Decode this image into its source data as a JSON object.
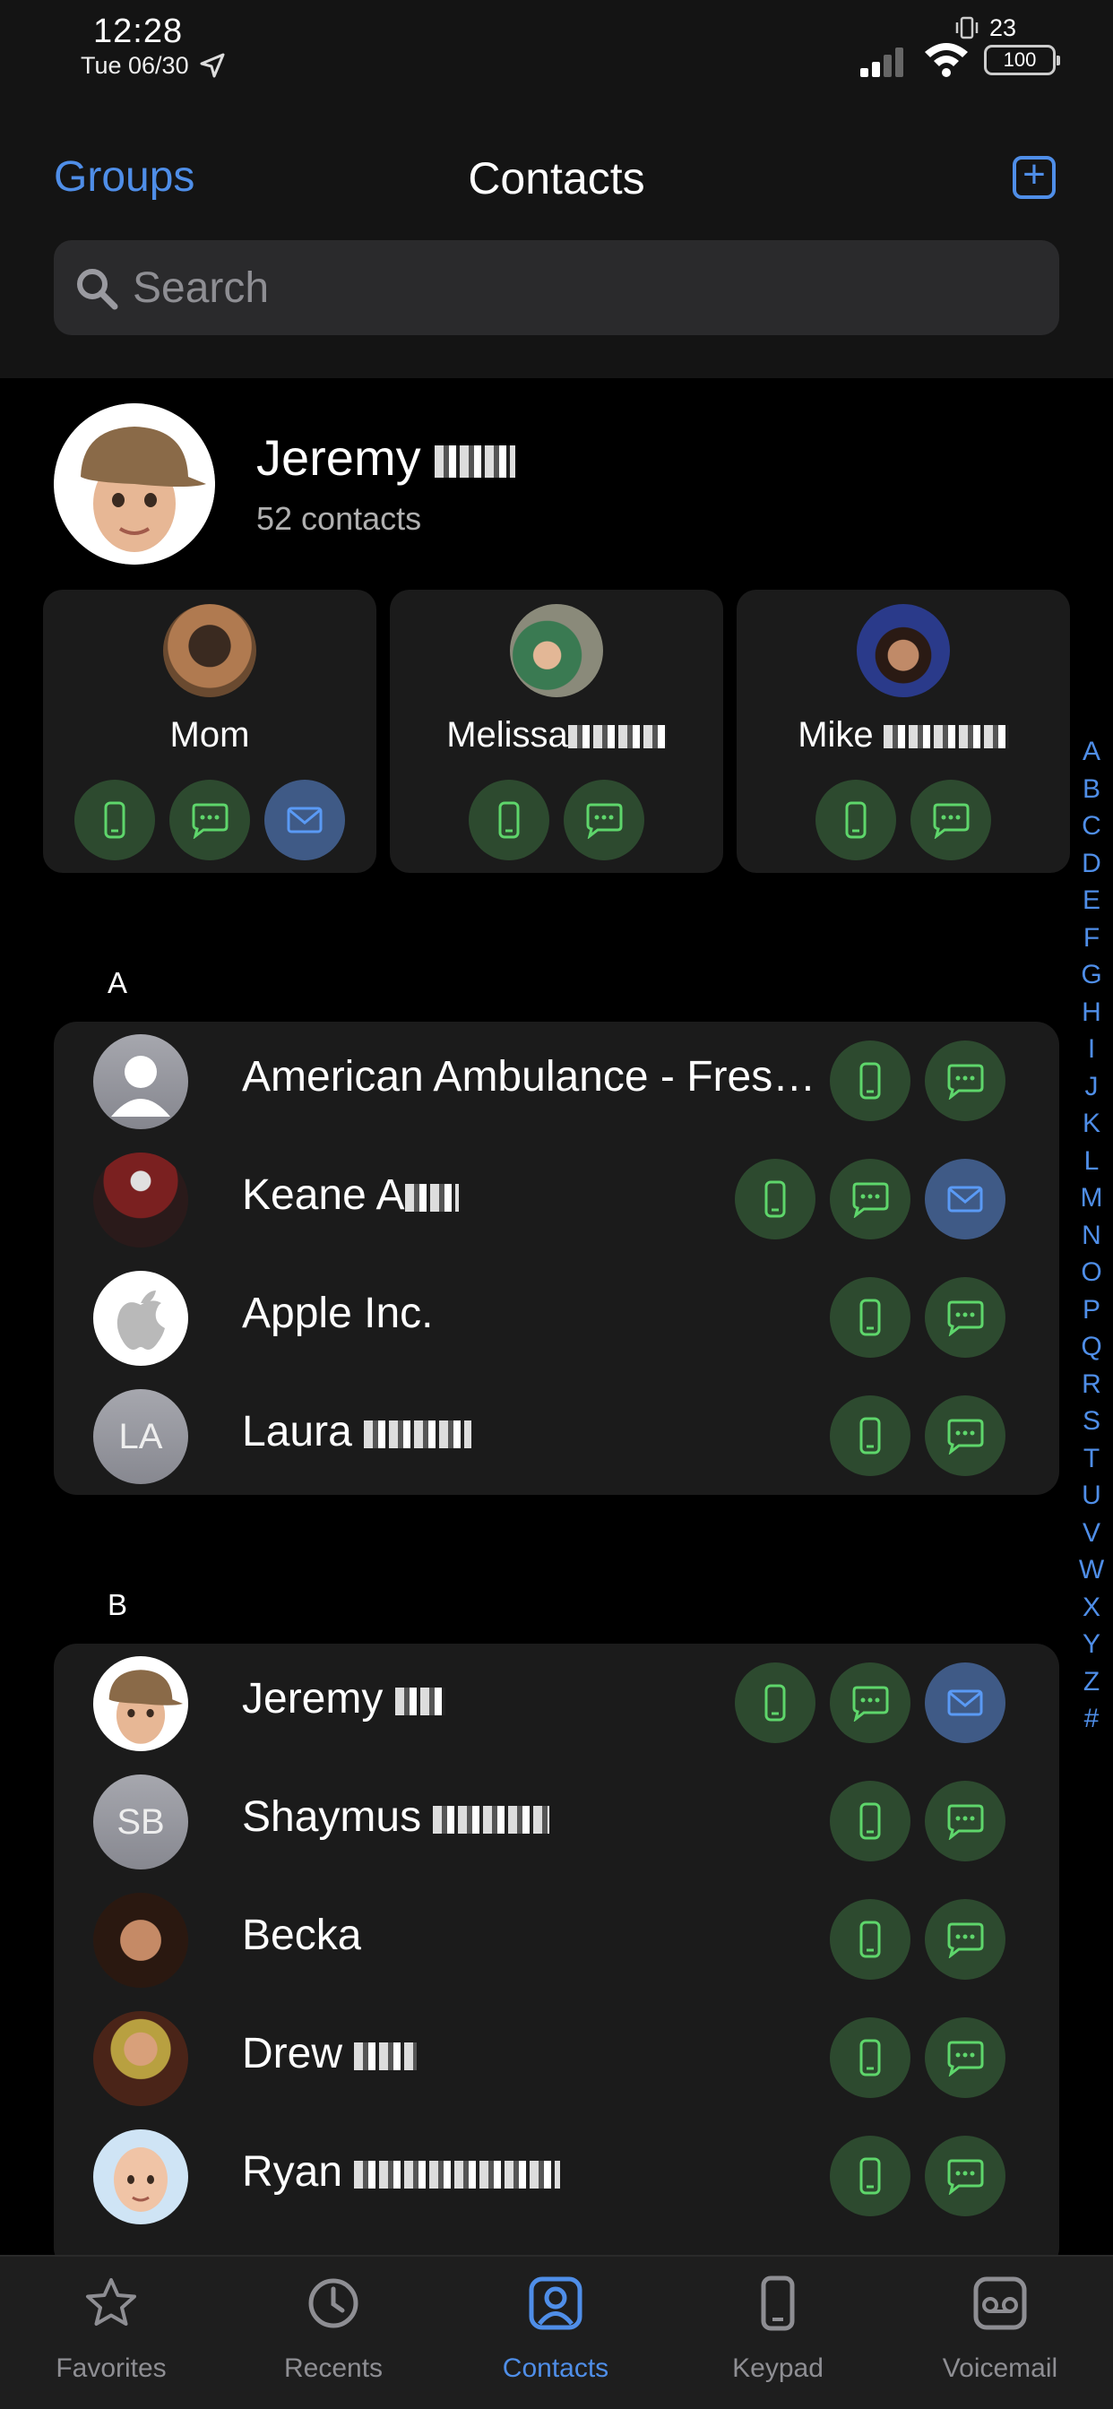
{
  "status_bar": {
    "time": "12:28",
    "date": "Tue 06/30",
    "notification_count": "23",
    "battery": "100"
  },
  "header": {
    "groups_label": "Groups",
    "title": "Contacts"
  },
  "search": {
    "placeholder": "Search"
  },
  "profile": {
    "name": "Jeremy",
    "subtitle": "52 contacts"
  },
  "favorites": [
    {
      "name": "Mom",
      "actions": [
        "phone",
        "message",
        "mail"
      ]
    },
    {
      "name": "Melissa",
      "actions": [
        "phone",
        "message"
      ]
    },
    {
      "name": "Mike",
      "actions": [
        "phone",
        "message"
      ]
    }
  ],
  "sections": [
    {
      "letter": "A",
      "contacts": [
        {
          "name": "American Ambulance - Fresno...",
          "avatar": "person-placeholder",
          "actions": [
            "phone",
            "message"
          ]
        },
        {
          "name": "Keane A",
          "avatar": "photo",
          "actions": [
            "phone",
            "message",
            "mail"
          ]
        },
        {
          "name": "Apple Inc.",
          "avatar": "apple-logo",
          "actions": [
            "phone",
            "message"
          ]
        },
        {
          "name": "Laura",
          "initials": "LA",
          "actions": [
            "phone",
            "message"
          ]
        }
      ]
    },
    {
      "letter": "B",
      "contacts": [
        {
          "name": "Jeremy",
          "avatar": "memoji",
          "actions": [
            "phone",
            "message",
            "mail"
          ]
        },
        {
          "name": "Shaymus",
          "initials": "SB",
          "actions": [
            "phone",
            "message"
          ]
        },
        {
          "name": "Becka",
          "avatar": "photo",
          "actions": [
            "phone",
            "message"
          ]
        },
        {
          "name": "Drew",
          "avatar": "photo",
          "actions": [
            "phone",
            "message"
          ]
        },
        {
          "name": "Ryan",
          "avatar": "memoji",
          "actions": [
            "phone",
            "message"
          ]
        }
      ]
    }
  ],
  "alphabet_index": [
    "A",
    "B",
    "C",
    "D",
    "E",
    "F",
    "G",
    "H",
    "I",
    "J",
    "K",
    "L",
    "M",
    "N",
    "O",
    "P",
    "Q",
    "R",
    "S",
    "T",
    "U",
    "V",
    "W",
    "X",
    "Y",
    "Z",
    "#"
  ],
  "tabs": [
    {
      "label": "Favorites",
      "icon": "star-icon",
      "active": false
    },
    {
      "label": "Recents",
      "icon": "clock-icon",
      "active": false
    },
    {
      "label": "Contacts",
      "icon": "person-icon",
      "active": true
    },
    {
      "label": "Keypad",
      "icon": "phone-icon",
      "active": false
    },
    {
      "label": "Voicemail",
      "icon": "voicemail-icon",
      "active": false
    }
  ],
  "colors": {
    "accent": "#4f8ee8",
    "action_green": "#5ed66b",
    "action_green_bg": "#2d4a2f",
    "mail_bg": "#3f5a86",
    "card_bg": "#1b1b1b"
  }
}
